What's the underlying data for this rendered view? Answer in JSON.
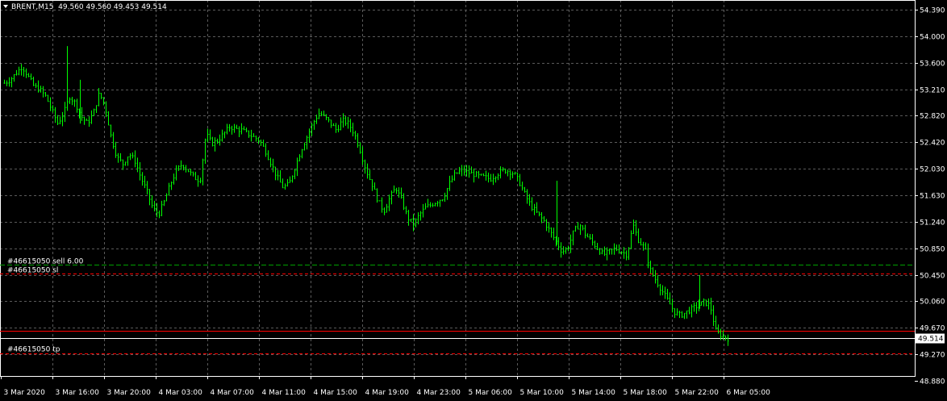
{
  "header": {
    "symbol": "BRENT,M15",
    "ohlc": "49.560 49.560 49.453 49.514"
  },
  "colors": {
    "background": "#000000",
    "grid": "#5a5a5a",
    "foreground": "#ffffff",
    "candle": "#00ff00",
    "order_line": "#00a000",
    "stop_line": "#ff0000",
    "bid_line": "#ffffff",
    "ask_line": "#ff0000"
  },
  "chart_data": {
    "type": "candlestick",
    "symbol": "BRENT",
    "timeframe": "M15",
    "y_ticks": [
      "54.390",
      "54.000",
      "53.600",
      "53.210",
      "52.820",
      "52.420",
      "52.030",
      "51.630",
      "51.240",
      "50.850",
      "50.450",
      "50.060",
      "49.670",
      "49.270",
      "48.880"
    ],
    "ylim": [
      48.88,
      54.39
    ],
    "x_ticks": [
      "3 Mar 2020",
      "3 Mar 16:00",
      "3 Mar 20:00",
      "4 Mar 03:00",
      "4 Mar 07:00",
      "4 Mar 11:00",
      "4 Mar 15:00",
      "4 Mar 19:00",
      "4 Mar 23:00",
      "5 Mar 06:00",
      "5 Mar 10:00",
      "5 Mar 14:00",
      "5 Mar 18:00",
      "5 Mar 22:00",
      "6 Mar 05:00"
    ],
    "grid": true,
    "closes": [
      53.3,
      53.35,
      53.45,
      53.55,
      53.4,
      53.25,
      53.2,
      53.1,
      52.9,
      52.7,
      52.85,
      53.1,
      53.0,
      52.8,
      52.7,
      52.85,
      53.15,
      52.95,
      52.5,
      52.2,
      52.1,
      52.25,
      52.15,
      51.9,
      51.7,
      51.45,
      51.35,
      51.55,
      51.8,
      52.0,
      52.1,
      52.0,
      51.9,
      51.85,
      52.55,
      52.4,
      52.45,
      52.55,
      52.65,
      52.62,
      52.6,
      52.55,
      52.5,
      52.45,
      52.3,
      52.1,
      51.9,
      51.75,
      51.8,
      52.05,
      52.3,
      52.5,
      52.7,
      52.85,
      52.8,
      52.7,
      52.6,
      52.75,
      52.7,
      52.55,
      52.3,
      52.0,
      51.8,
      51.55,
      51.4,
      51.6,
      51.75,
      51.55,
      51.3,
      51.2,
      51.35,
      51.45,
      51.5,
      51.55,
      51.6,
      51.8,
      51.95,
      52.0,
      51.98,
      51.95,
      51.92,
      51.9,
      51.88,
      51.95,
      52.0,
      52.0,
      51.95,
      51.8,
      51.6,
      51.45,
      51.35,
      51.25,
      51.1,
      50.95,
      50.8,
      50.85,
      51.1,
      51.2,
      51.05,
      50.95,
      50.85,
      50.75,
      50.8,
      50.85,
      50.8,
      50.75,
      51.2,
      50.95,
      50.85,
      50.5,
      50.35,
      50.2,
      50.05,
      49.9,
      49.85,
      49.9,
      49.95,
      50.0,
      50.05,
      50.0,
      49.6,
      49.55,
      49.51
    ]
  },
  "trade": {
    "order_label": "#46615050 sell 6.00",
    "order_price": 50.6,
    "sl_label": "#46615050 sl",
    "sl_price": 50.47,
    "tp_label": "#46615050 tp",
    "tp_price": 49.29
  },
  "ask_line_price": 49.62,
  "current_price": "49.514"
}
